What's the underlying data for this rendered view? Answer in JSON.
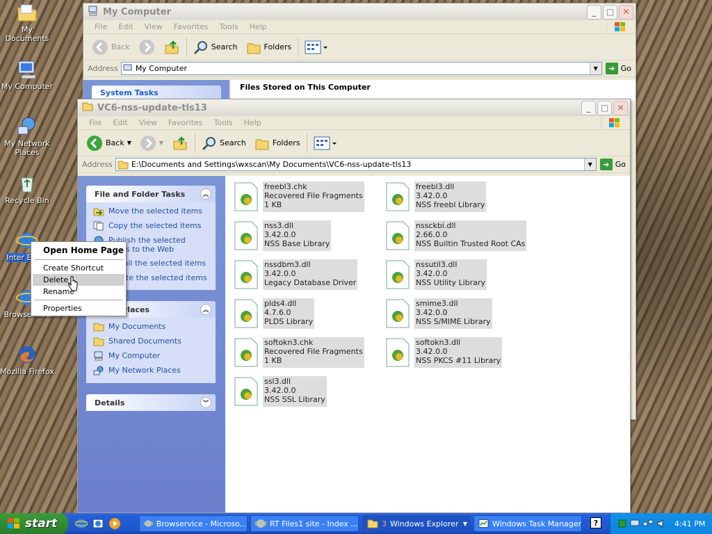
{
  "desktop": {
    "icons": [
      {
        "label": "My Documents",
        "icon": "folder-documents-icon"
      },
      {
        "label": "My Computer",
        "icon": "computer-icon"
      },
      {
        "label": "My Network Places",
        "icon": "network-icon"
      },
      {
        "label": "Recycle Bin",
        "icon": "recycle-bin-icon"
      },
      {
        "label": "Internet Explorer",
        "icon": "ie-icon",
        "visible_label": "Inter Explo"
      },
      {
        "label": "Browservice",
        "icon": "browser-icon",
        "visible_label": "Browservice"
      },
      {
        "label": "Mozilla Firefox",
        "icon": "firefox-icon"
      }
    ]
  },
  "back_window": {
    "title": "My Computer",
    "menu": [
      "File",
      "Edit",
      "View",
      "Favorites",
      "Tools",
      "Help"
    ],
    "toolbar": {
      "back": "Back",
      "search": "Search",
      "folders": "Folders"
    },
    "address_label": "Address",
    "address_value": "My Computer",
    "go": "Go",
    "section_heading": "Files Stored on This Computer",
    "left_panel_partial": "System Tasks"
  },
  "front_window": {
    "title": "VC6-nss-update-tls13",
    "menu": [
      "File",
      "Edit",
      "View",
      "Favorites",
      "Tools",
      "Help"
    ],
    "toolbar": {
      "back": "Back",
      "search": "Search",
      "folders": "Folders"
    },
    "address_label": "Address",
    "address_value": "E:\\Documents and Settings\\wxscan\\My Documents\\VC6-nss-update-tls13",
    "go": "Go",
    "tasks": {
      "title": "File and Folder Tasks",
      "items": [
        "Move the selected items",
        "Copy the selected items",
        "Publish the selected items to the Web",
        "E-mail the selected items",
        "Delete the selected items"
      ]
    },
    "places": {
      "title": "Other Places",
      "items": [
        "My Documents",
        "Shared Documents",
        "My Computer",
        "My Network Places"
      ]
    },
    "details": {
      "title": "Details"
    },
    "files": [
      {
        "name": "freebl3.chk",
        "line2": "Recovered File Fragments",
        "line3": "1 KB"
      },
      {
        "name": "freebl3.dll",
        "line2": "3.42.0.0",
        "line3": "NSS freebl Library"
      },
      {
        "name": "nss3.dll",
        "line2": "3.42.0.0",
        "line3": "NSS Base Library"
      },
      {
        "name": "nssckbi.dll",
        "line2": "2.66.0.0",
        "line3": "NSS Builtin Trusted Root CAs"
      },
      {
        "name": "nssdbm3.dll",
        "line2": "3.42.0.0",
        "line3": "Legacy Database Driver"
      },
      {
        "name": "nssutil3.dll",
        "line2": "3.42.0.0",
        "line3": "NSS Utility Library"
      },
      {
        "name": "plds4.dll",
        "line2": "4.7.6.0",
        "line3": "PLDS Library"
      },
      {
        "name": "smime3.dll",
        "line2": "3.42.0.0",
        "line3": "NSS S/MIME Library"
      },
      {
        "name": "softokn3.chk",
        "line2": "Recovered File Fragments",
        "line3": "1 KB"
      },
      {
        "name": "softokn3.dll",
        "line2": "3.42.0.0",
        "line3": "NSS PKCS #11 Library"
      },
      {
        "name": "ssl3.dll",
        "line2": "3.42.0.0",
        "line3": "NSS SSL Library"
      }
    ]
  },
  "context_menu": {
    "open": "Open Home Page",
    "create_shortcut": "Create Shortcut",
    "delete": "Delete",
    "rename": "Rename",
    "properties": "Properties"
  },
  "taskbar": {
    "start": "start",
    "tasks": [
      {
        "label": "Browservice - Microso...",
        "icon": "ie-icon"
      },
      {
        "label": "RT Files1 site - Index ...",
        "icon": "ie-icon"
      },
      {
        "label": "Windows Explorer",
        "count": "3",
        "icon": "folder-icon"
      },
      {
        "label": "Windows Task Manager",
        "icon": "task-manager-icon"
      }
    ],
    "clock": "4:41 PM",
    "help_glyph": "?"
  }
}
